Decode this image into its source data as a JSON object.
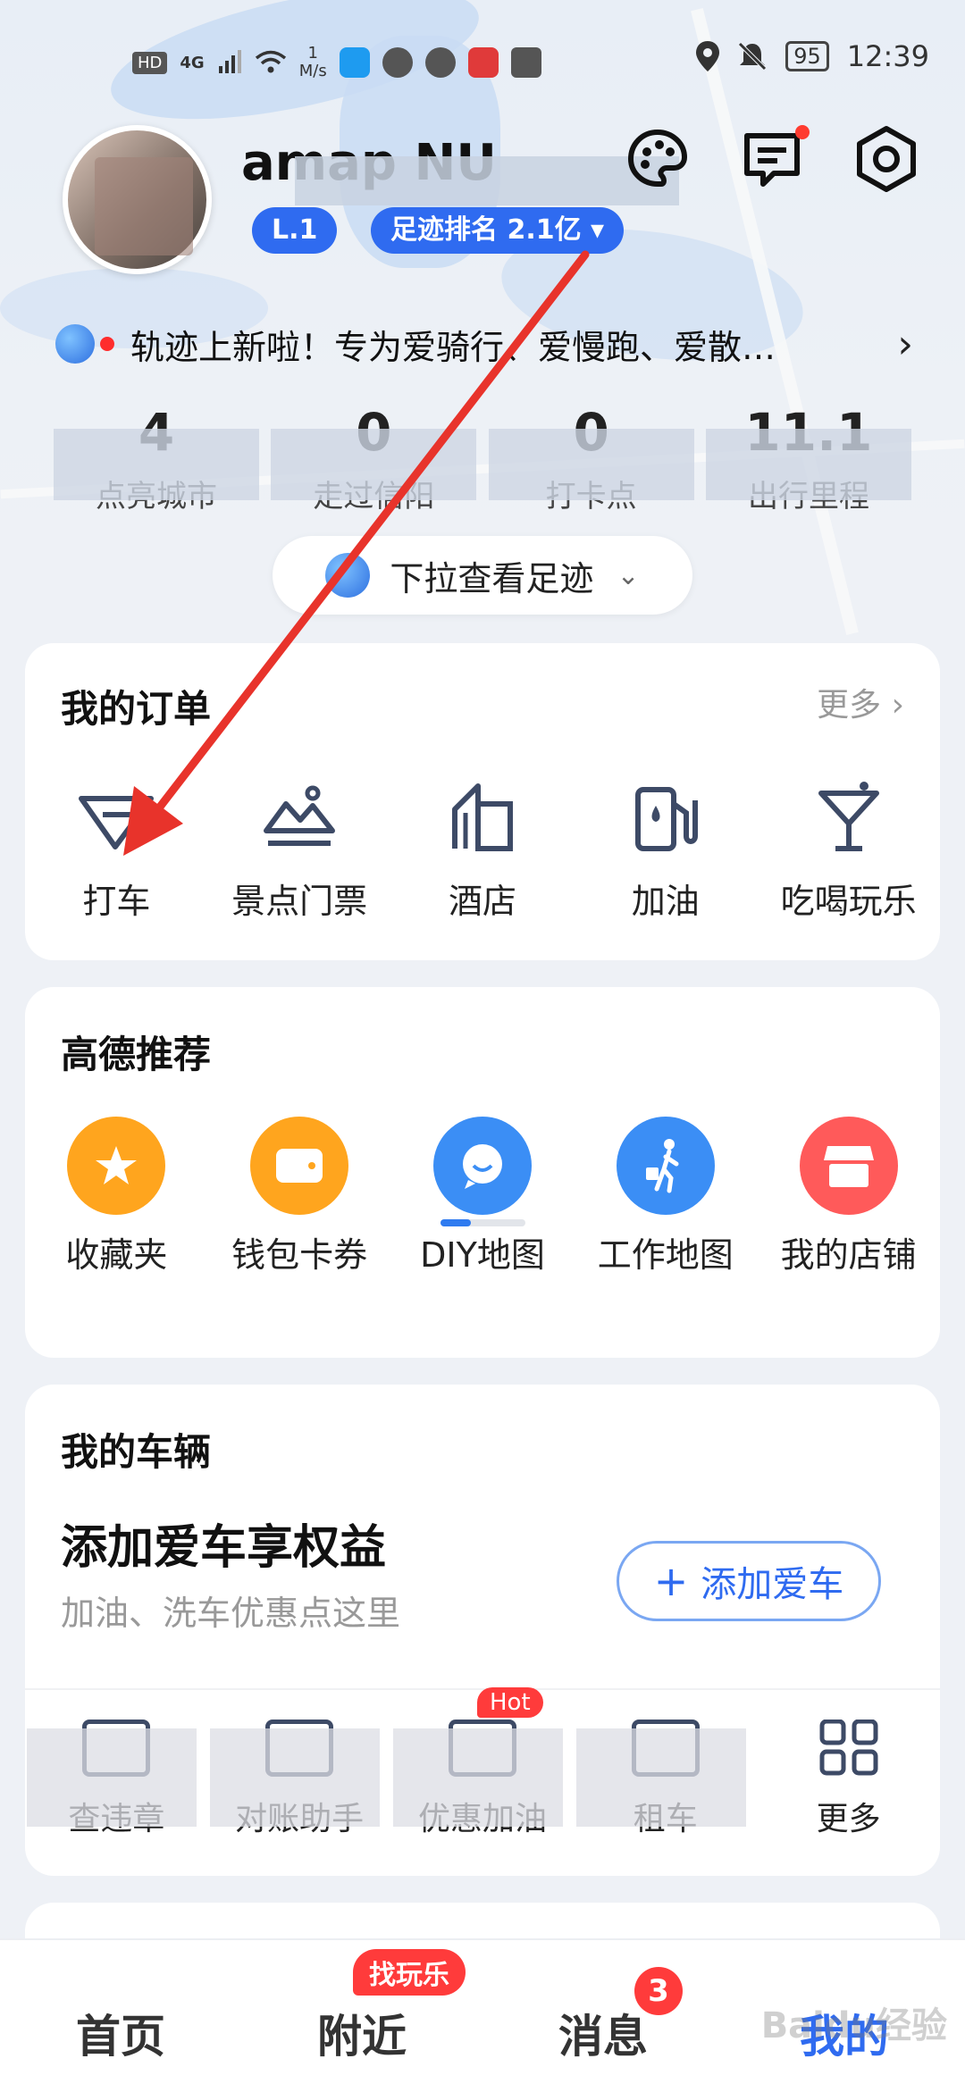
{
  "status_bar": {
    "hd": "HD",
    "network": "4G",
    "speed_value": "1",
    "speed_unit": "M/s",
    "battery": "95",
    "time": "12:39"
  },
  "profile": {
    "username": "amap NU",
    "chip_level": "L.1",
    "chip_rank": "足迹排名 2.1亿 ▾"
  },
  "announcement": {
    "text": "轨迹上新啦！专为爱骑行、爱慢跑、爱散…"
  },
  "stats": [
    {
      "value": "4",
      "label": "点亮城市"
    },
    {
      "value": "0",
      "label": "走过信阳"
    },
    {
      "value": "0",
      "label": "打卡点"
    },
    {
      "value": "11.1",
      "label": "出行里程"
    }
  ],
  "pull_tip": "下拉查看足迹",
  "orders": {
    "title": "我的订单",
    "more": "更多",
    "items": [
      {
        "label": "打车",
        "icon": "taxi-icon"
      },
      {
        "label": "景点门票",
        "icon": "scenic-ticket-icon"
      },
      {
        "label": "酒店",
        "icon": "hotel-icon"
      },
      {
        "label": "加油",
        "icon": "fuel-icon"
      },
      {
        "label": "吃喝玩乐",
        "icon": "cocktail-icon"
      }
    ]
  },
  "recommend": {
    "title": "高德推荐",
    "items": [
      {
        "label": "收藏夹",
        "icon": "star-icon",
        "color": "#ffa51e"
      },
      {
        "label": "钱包卡券",
        "icon": "wallet-icon",
        "color": "#ffa51e"
      },
      {
        "label": "DIY地图",
        "icon": "chat-face-icon",
        "color": "#3b8ef5"
      },
      {
        "label": "工作地图",
        "icon": "walker-icon",
        "color": "#3b8ef5"
      },
      {
        "label": "我的店铺",
        "icon": "store-icon",
        "color": "#ff5a5a"
      }
    ]
  },
  "vehicle": {
    "title": "我的车辆",
    "headline": "添加爱车享权益",
    "desc": "加油、洗车优惠点这里",
    "add_button": "添加爱车",
    "tools": [
      {
        "label": "查违章",
        "hot": ""
      },
      {
        "label": "对账助手",
        "hot": ""
      },
      {
        "label": "优惠加油",
        "hot": "Hot"
      },
      {
        "label": "租车",
        "hot": ""
      },
      {
        "label": "更多",
        "hot": ""
      }
    ]
  },
  "tabbar": {
    "tabs": [
      {
        "label": "首页"
      },
      {
        "label": "附近",
        "badge": "找玩乐"
      },
      {
        "label": "消息",
        "count": "3"
      },
      {
        "label": "我的"
      }
    ]
  },
  "watermark": "Baidu经验",
  "colors": {
    "accent": "#2f6bf0",
    "annotation_arrow": "#e8332b"
  }
}
